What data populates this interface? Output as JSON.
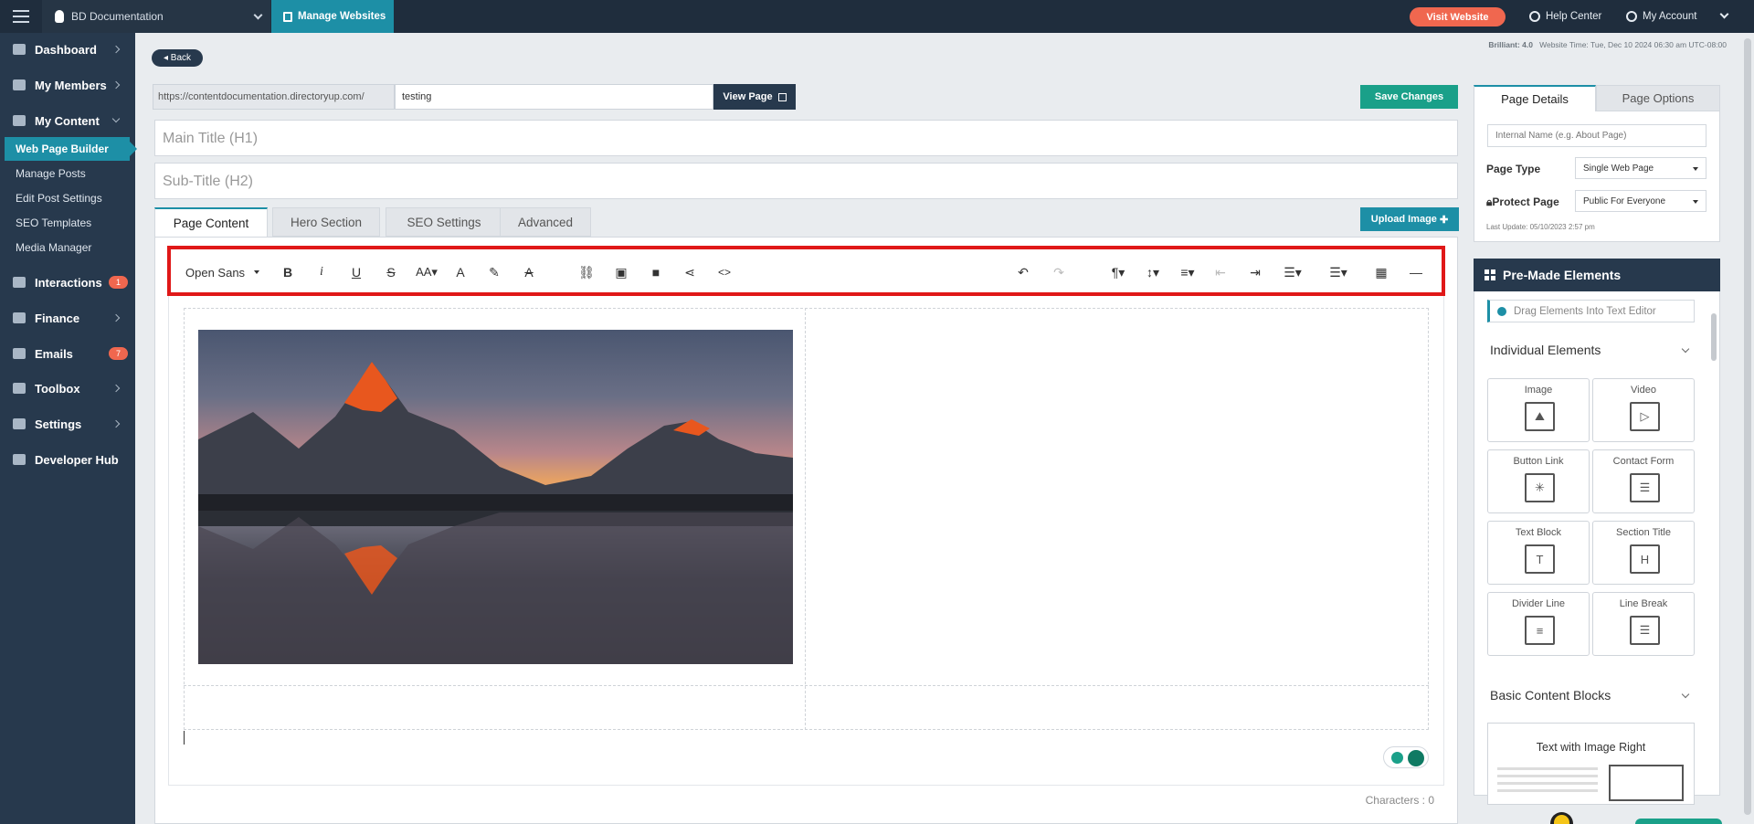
{
  "topbar": {
    "site_name": "BD Documentation",
    "manage_websites": "Manage Websites",
    "visit_website": "Visit Website",
    "help_center": "Help Center",
    "my_account": "My Account"
  },
  "sidebar": {
    "items": [
      {
        "label": "Dashboard",
        "icon": "home-icon"
      },
      {
        "label": "My Members",
        "icon": "users-icon"
      },
      {
        "label": "My Content",
        "icon": "folder-icon"
      },
      {
        "label": "Interactions",
        "icon": "chat-icon",
        "badge": "1"
      },
      {
        "label": "Finance",
        "icon": "pie-chart-icon"
      },
      {
        "label": "Emails",
        "icon": "inbox-icon",
        "badge": "7"
      },
      {
        "label": "Toolbox",
        "icon": "wrench-icon"
      },
      {
        "label": "Settings",
        "icon": "gear-icon"
      },
      {
        "label": "Developer Hub",
        "icon": "grid-icon"
      }
    ],
    "sub_items": [
      "Web Page Builder",
      "Manage Posts",
      "Edit Post Settings",
      "SEO Templates",
      "Media Manager"
    ],
    "active_sub_item": "Web Page Builder"
  },
  "page": {
    "back_label": "Back",
    "meta_brilliant": "Brilliant: 4.0",
    "meta_time": "Website Time: Tue, Dec 10 2024 06:30 am UTC-08:00",
    "url_prefix": "https://contentdocumentation.directoryup.com/",
    "url_value": "testing",
    "view_page": "View Page",
    "save_changes": "Save Changes",
    "main_title_placeholder": "Main Title (H1)",
    "sub_title_placeholder": "Sub-Title (H2)",
    "upload_image": "Upload Image"
  },
  "tabs": [
    "Page Content",
    "Hero Section",
    "SEO Settings",
    "Advanced"
  ],
  "active_tab": "Page Content",
  "toolbar": {
    "font": "Open Sans",
    "buttons": [
      "bold",
      "italic",
      "underline",
      "strikethrough",
      "font-size",
      "text-color",
      "highlight",
      "clear-format",
      "link",
      "image",
      "video",
      "share",
      "code",
      "undo",
      "redo",
      "paragraph-format",
      "line-height",
      "align",
      "outdent",
      "indent",
      "ordered-list",
      "unordered-list",
      "table",
      "horizontal-line"
    ]
  },
  "editor": {
    "characters": "Characters : 0"
  },
  "right_panel": {
    "tabs": [
      "Page Details",
      "Page Options"
    ],
    "active_tab": "Page Details",
    "internal_name_placeholder": "Internal Name (e.g. About Page)",
    "page_type_label": "Page Type",
    "page_type_value": "Single Web Page",
    "protect_label": "Protect Page",
    "protect_value": "Public For Everyone",
    "last_update": "Last Update: 05/10/2023 2:57 pm",
    "premade_title": "Pre-Made Elements",
    "drag_hint": "Drag Elements Into Text Editor",
    "individual_title": "Individual Elements",
    "elements": [
      "Image",
      "Video",
      "Button Link",
      "Contact Form",
      "Text Block",
      "Section Title",
      "Divider Line",
      "Line Break"
    ],
    "basic_blocks_title": "Basic Content Blocks",
    "block_1": "Text with Image Right"
  },
  "colors": {
    "navy": "#27394d",
    "teal": "#1d8fa6",
    "green": "#1aa089",
    "orange": "#f0674f",
    "highlight_red": "#e01818"
  }
}
